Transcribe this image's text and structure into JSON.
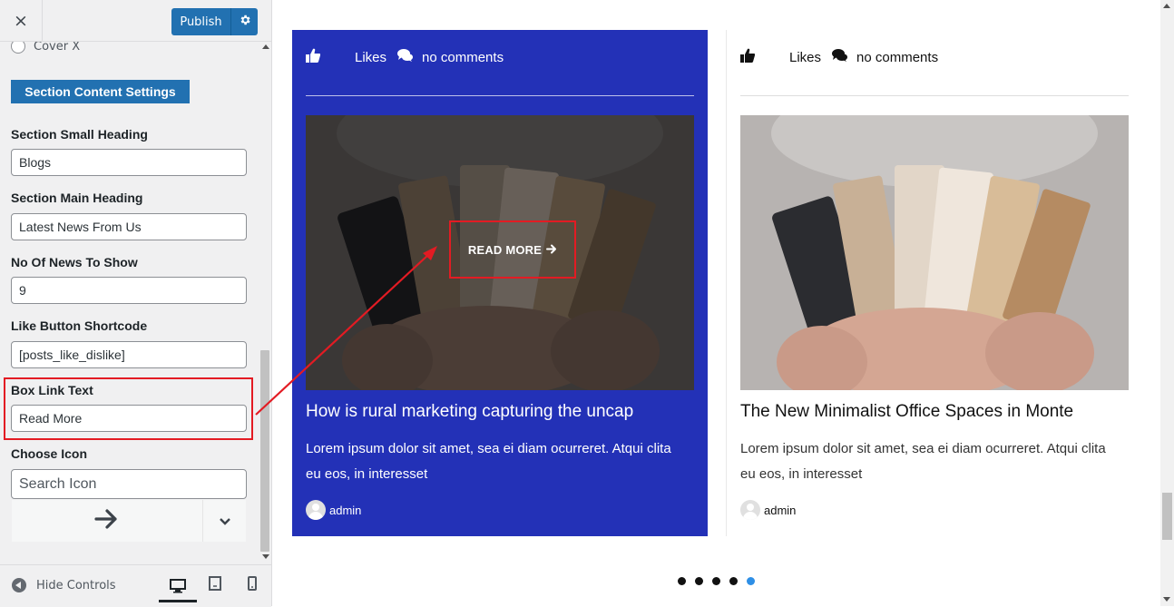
{
  "topbar": {
    "close_icon": "×",
    "publish_label": "Publish",
    "gear_icon": "gear-icon"
  },
  "panel": {
    "radio_option": "Cover X",
    "section_button": "Section Content Settings",
    "fields": {
      "small_heading": {
        "label": "Section Small Heading",
        "value": "Blogs"
      },
      "main_heading": {
        "label": "Section Main Heading",
        "value": "Latest News From Us"
      },
      "news_count": {
        "label": "No Of News To Show",
        "value": "9"
      },
      "like_shortcode": {
        "label": "Like Button Shortcode",
        "value": "[posts_like_dislike]"
      },
      "box_link_text": {
        "label": "Box Link Text",
        "value": "Read More"
      },
      "choose_icon": {
        "label": "Choose Icon",
        "placeholder": "Search Icon"
      }
    }
  },
  "footer": {
    "hide_controls": "Hide Controls"
  },
  "preview": {
    "cards": [
      {
        "likes": "Likes",
        "comments": "no comments",
        "read_more": "READ MORE",
        "title": "How is rural marketing capturing the uncap",
        "text": "Lorem ipsum dolor sit amet, sea ei diam ocurreret. Atqui clita eu eos, in interesset",
        "author": "admin"
      },
      {
        "likes": "Likes",
        "comments": "no comments",
        "title": "The New Minimalist Office Spaces in Monte",
        "text": "Lorem ipsum dolor sit amet, sea ei diam ocurreret. Atqui clita eu eos, in interesset",
        "author": "admin"
      }
    ],
    "pagination": {
      "pages": 5,
      "active": 5
    }
  },
  "colors": {
    "accent": "#2271b1",
    "card_blue": "#2331b7",
    "highlight": "#e31b23",
    "dot_active": "#2e8fe6"
  }
}
